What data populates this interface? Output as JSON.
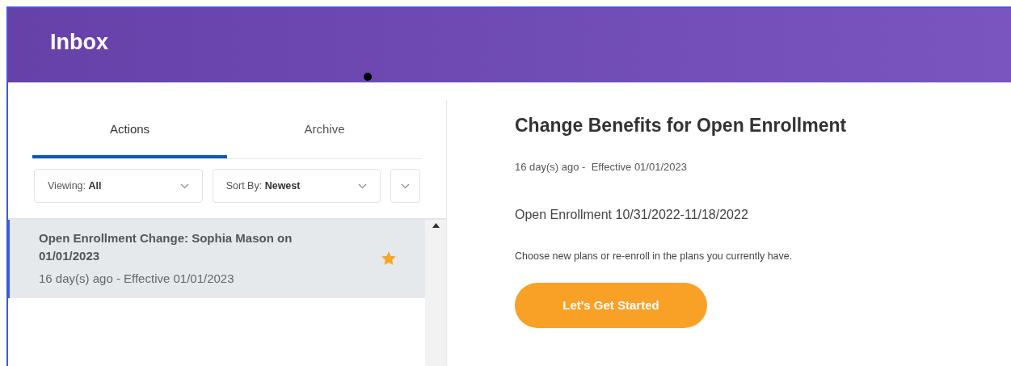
{
  "header": {
    "title": "Inbox"
  },
  "tabs": [
    {
      "label": "Actions",
      "selected": true
    },
    {
      "label": "Archive",
      "selected": false
    }
  ],
  "filters": [
    {
      "label": "Viewing:",
      "value": "All"
    },
    {
      "label": "Sort By:",
      "value": "Newest"
    }
  ],
  "items": [
    {
      "title": "Open Enrollment Change: Sophia Mason on 01/01/2023",
      "subtitle": "16 day(s) ago - Effective 01/01/2023",
      "starred": true,
      "selected": true
    }
  ],
  "detail": {
    "title": "Change Benefits for Open Enrollment",
    "meta": "16 day(s) ago -  Effective 01/01/2023",
    "period": "Open Enrollment 10/31/2022-11/18/2022",
    "description": "Choose new plans or re-enroll in the plans you currently have.",
    "button": "Let's Get Started"
  }
}
